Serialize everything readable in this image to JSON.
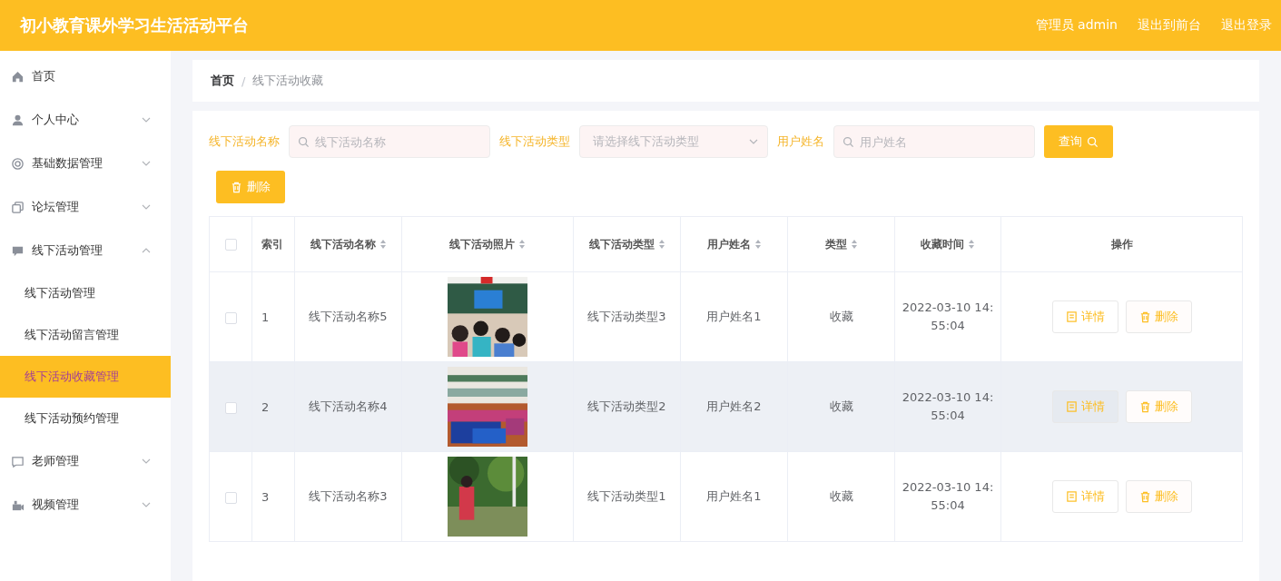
{
  "header": {
    "title": "初小教育课外学习生活活动平台",
    "user": "管理员 admin",
    "links": [
      "退出到前台",
      "退出登录"
    ]
  },
  "sidebar": {
    "items": [
      {
        "label": "首页"
      },
      {
        "label": "个人中心",
        "expanded": false
      },
      {
        "label": "基础数据管理",
        "expanded": false
      },
      {
        "label": "论坛管理",
        "expanded": false
      },
      {
        "label": "线下活动管理",
        "expanded": true,
        "children": [
          {
            "label": "线下活动管理",
            "selected": false
          },
          {
            "label": "线下活动留言管理",
            "selected": false
          },
          {
            "label": "线下活动收藏管理",
            "selected": true
          },
          {
            "label": "线下活动预约管理",
            "selected": false
          }
        ]
      },
      {
        "label": "老师管理",
        "expanded": false
      },
      {
        "label": "视频管理",
        "expanded": false
      }
    ]
  },
  "breadcrumb": {
    "separator": "/",
    "items": [
      "首页",
      "线下活动收藏"
    ]
  },
  "filters": [
    {
      "kind": "text",
      "label": "线下活动名称",
      "placeholder": "线下活动名称"
    },
    {
      "kind": "select",
      "label": "线下活动类型",
      "placeholder": "请选择线下活动类型"
    },
    {
      "kind": "text",
      "label": "用户姓名",
      "placeholder": "用户姓名"
    }
  ],
  "search_button": "查询",
  "delete_button": "删除",
  "table": {
    "select_all": {
      "checked": false
    },
    "columns": [
      {
        "label": "索引",
        "sortable": false
      },
      {
        "label": "线下活动名称",
        "sortable": true
      },
      {
        "label": "线下活动照片",
        "sortable": true
      },
      {
        "label": "线下活动类型",
        "sortable": true
      },
      {
        "label": "用户姓名",
        "sortable": true
      },
      {
        "label": "类型",
        "sortable": true
      },
      {
        "label": "收藏时间",
        "sortable": true
      },
      {
        "label": "操作",
        "sortable": false
      }
    ],
    "rows": [
      {
        "checked": false,
        "hovered": false,
        "index": "1",
        "name": "线下活动名称5",
        "photo": {
          "kind": "picture"
        },
        "type": "线下活动类型3",
        "user": "用户姓名1",
        "kind": "收藏",
        "time": "2022-03-10 14:55:04",
        "actions": [
          "详情",
          "删除"
        ]
      },
      {
        "checked": false,
        "hovered": true,
        "index": "2",
        "name": "线下活动名称4",
        "photo": {
          "kind": "picture"
        },
        "type": "线下活动类型2",
        "user": "用户姓名2",
        "kind": "收藏",
        "time": "2022-03-10 14:55:04",
        "actions": [
          "详情",
          "删除"
        ]
      },
      {
        "checked": false,
        "hovered": false,
        "index": "3",
        "name": "线下活动名称3",
        "photo": {
          "kind": "picture"
        },
        "type": "线下活动类型1",
        "user": "用户姓名1",
        "kind": "收藏",
        "time": "2022-03-10 14:55:04",
        "actions": [
          "详情",
          "删除"
        ]
      }
    ]
  }
}
